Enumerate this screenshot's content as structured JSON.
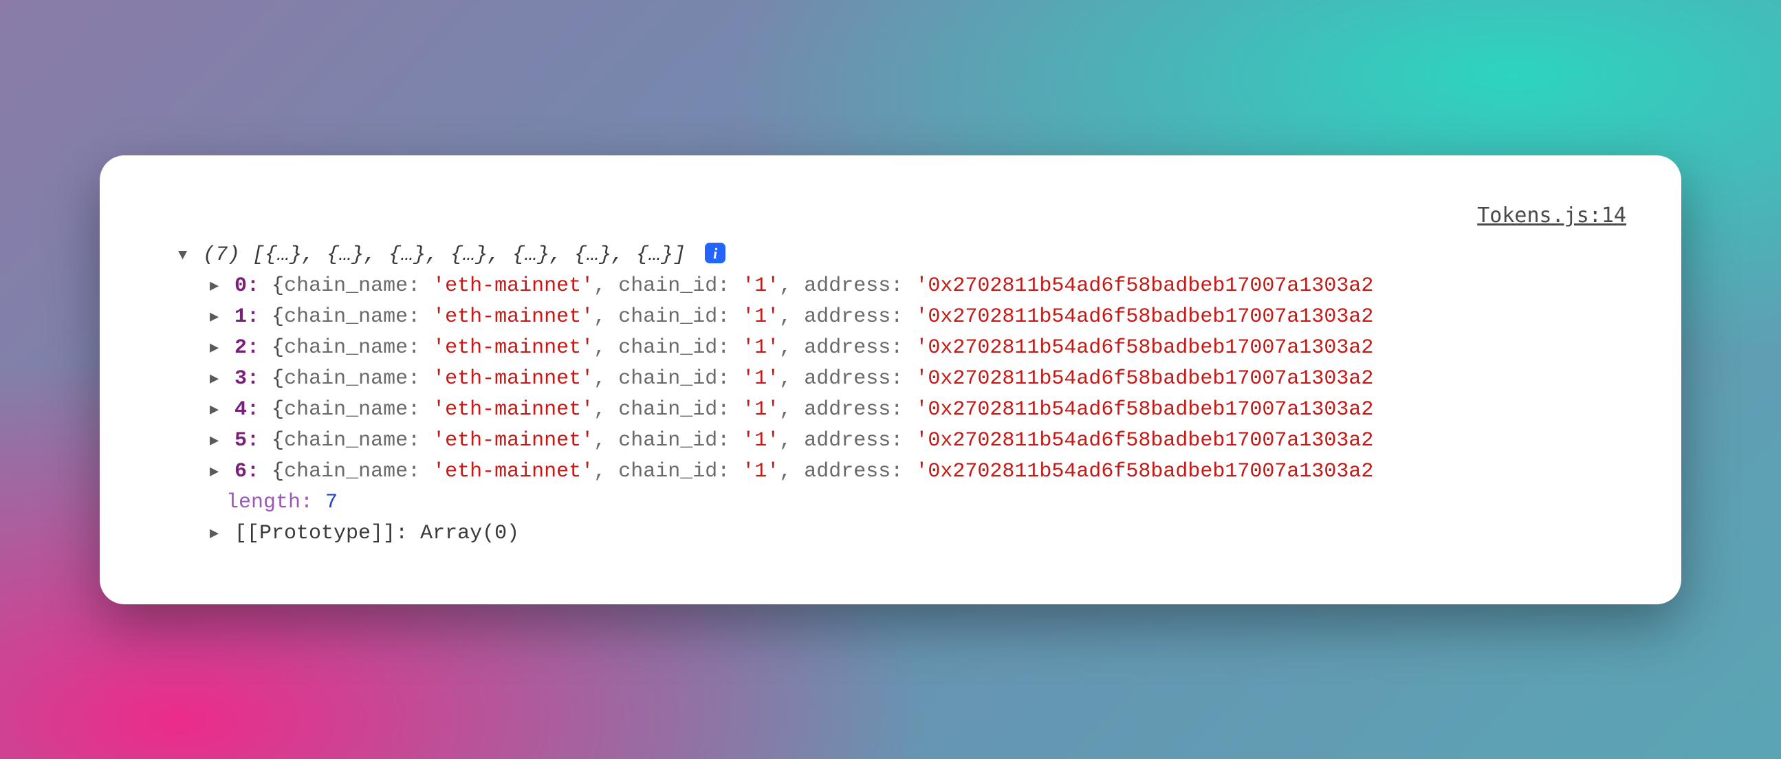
{
  "source": {
    "file": "Tokens.js",
    "line": "14",
    "text": "Tokens.js:14"
  },
  "array": {
    "count": "(7)",
    "summary": "[{…}, {…}, {…}, {…}, {…}, {…}, {…}]",
    "length_label": "length",
    "length_value": "7",
    "prototype_label": "[[Prototype]]",
    "prototype_value": "Array(0)",
    "items": [
      {
        "index": "0",
        "chain_name": "'eth-mainnet'",
        "chain_id": "'1'",
        "address": "'0x2702811b54ad6f58badbeb17007a1303a2"
      },
      {
        "index": "1",
        "chain_name": "'eth-mainnet'",
        "chain_id": "'1'",
        "address": "'0x2702811b54ad6f58badbeb17007a1303a2"
      },
      {
        "index": "2",
        "chain_name": "'eth-mainnet'",
        "chain_id": "'1'",
        "address": "'0x2702811b54ad6f58badbeb17007a1303a2"
      },
      {
        "index": "3",
        "chain_name": "'eth-mainnet'",
        "chain_id": "'1'",
        "address": "'0x2702811b54ad6f58badbeb17007a1303a2"
      },
      {
        "index": "4",
        "chain_name": "'eth-mainnet'",
        "chain_id": "'1'",
        "address": "'0x2702811b54ad6f58badbeb17007a1303a2"
      },
      {
        "index": "5",
        "chain_name": "'eth-mainnet'",
        "chain_id": "'1'",
        "address": "'0x2702811b54ad6f58badbeb17007a1303a2"
      },
      {
        "index": "6",
        "chain_name": "'eth-mainnet'",
        "chain_id": "'1'",
        "address": "'0x2702811b54ad6f58badbeb17007a1303a2"
      }
    ]
  },
  "keys": {
    "chain_name": "chain_name:",
    "chain_id": "chain_id:",
    "address": "address:"
  }
}
